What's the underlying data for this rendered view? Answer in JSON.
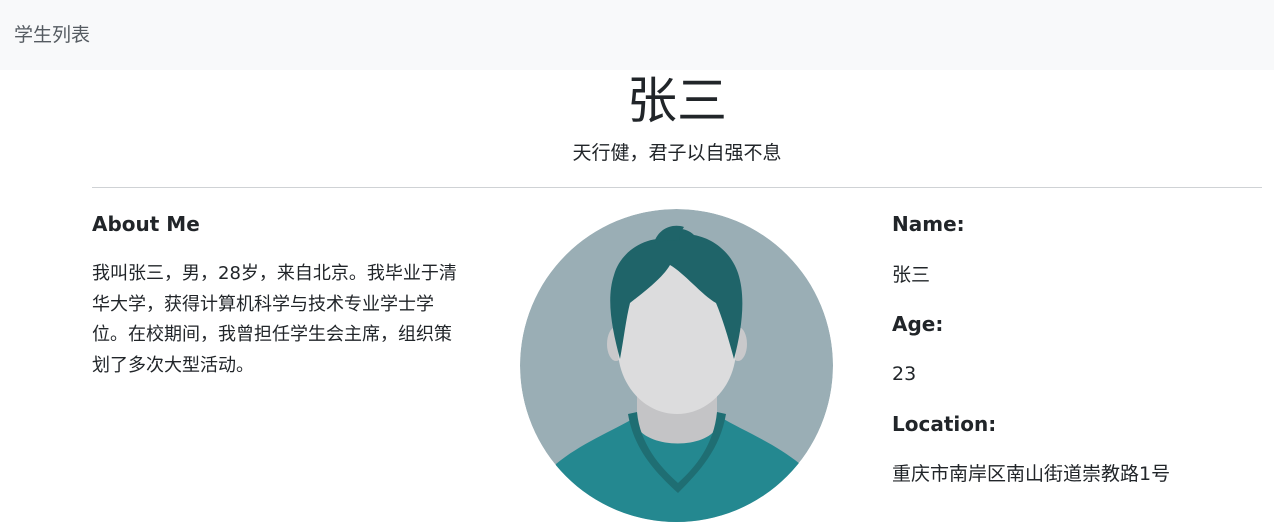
{
  "navbar": {
    "brand": "学生列表"
  },
  "profile": {
    "name": "张三",
    "motto": "天行健，君子以自强不息"
  },
  "about": {
    "heading": "About Me",
    "text": "我叫张三，男，28岁，来自北京。我毕业于清华大学，获得计算机科学与技术专业学士学位。在校期间，我曾担任学生会主席，组织策划了多次大型活动。"
  },
  "avatar": {
    "icon": "user-avatar-icon",
    "colors": {
      "background": "#9aaeb5",
      "hair": "#1f6469",
      "skin": "#dcdcdd",
      "shadow": "#c4c4c6",
      "shirt": "#248890"
    }
  },
  "info": {
    "name_label": "Name:",
    "name_value": "张三",
    "age_label": "Age:",
    "age_value": "23",
    "location_label": "Location:",
    "location_value": "重庆市南岸区南山街道崇教路1号"
  }
}
